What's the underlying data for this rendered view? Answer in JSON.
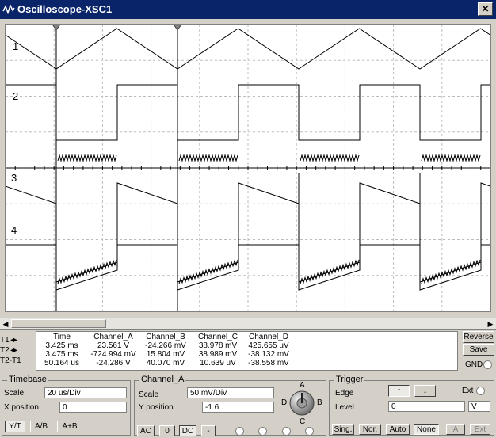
{
  "window": {
    "title": "Oscilloscope-XSC1",
    "close_label": "✕"
  },
  "screen": {
    "channel_labels": [
      "1",
      "2",
      "3",
      "4"
    ],
    "cursor_markers": [
      "T1",
      "T2"
    ]
  },
  "cursors": {
    "rows": [
      {
        "label": "T1",
        "arrows": "◂▸"
      },
      {
        "label": "T2",
        "arrows": "◂▸"
      },
      {
        "label": "T2-T1",
        "arrows": ""
      }
    ]
  },
  "readout": {
    "headers": [
      "Time",
      "Channel_A",
      "Channel_B",
      "Channel_C",
      "Channel_D"
    ],
    "rows": [
      [
        "3.425 ms",
        "23.561 V",
        "-24.266 mV",
        "38.978 mV",
        "425.655 uV"
      ],
      [
        "3.475 ms",
        "-724.994 mV",
        "15.804 mV",
        "38.989 mV",
        "-38.132 mV"
      ],
      [
        "50.164 us",
        "-24.286 V",
        "40.070 mV",
        "10.639 uV",
        "-38.558 mV"
      ]
    ]
  },
  "side_buttons": {
    "reverse": "Reverse",
    "save": "Save",
    "gnd": "GND"
  },
  "timebase": {
    "title": "Timebase",
    "scale_label": "Scale",
    "scale_value": "20 us/Div",
    "xpos_label": "X position",
    "xpos_value": "0",
    "buttons": [
      "Y/T",
      "A/B",
      "A+B"
    ]
  },
  "channel_a": {
    "title": "Channel_A",
    "scale_label": "Scale",
    "scale_value": "50 mV/Div",
    "ypos_label": "Y position",
    "ypos_value": "-1.6",
    "buttons": [
      "AC",
      "0",
      "DC",
      "-"
    ],
    "knob_labels": {
      "a": "A",
      "b": "B",
      "c": "C",
      "d": "D"
    }
  },
  "trigger": {
    "title": "Trigger",
    "edge_label": "Edge",
    "edge_rise": "↑",
    "edge_fall": "↓",
    "ext_label": "Ext",
    "level_label": "Level",
    "level_value": "0",
    "level_unit": "V",
    "buttons": [
      "Sing.",
      "Nor.",
      "Auto",
      "None"
    ],
    "a_label": "A",
    "ext_button": "Ext"
  },
  "colors": {
    "titlebar": "#0a246a",
    "background": "#d4d0c8",
    "trace": "#000000",
    "grid": "#bdbdbd"
  }
}
